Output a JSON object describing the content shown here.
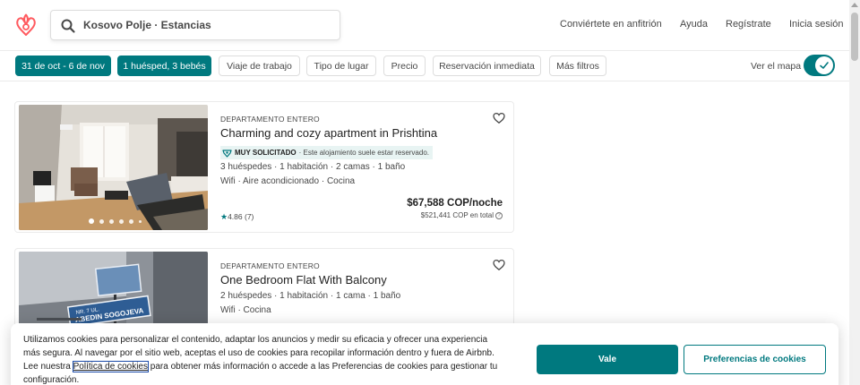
{
  "header": {
    "logo_icon": "airbnb-logo",
    "search_value": "Kosovo Polje · Estancias",
    "nav": [
      "Conviértete en anfitrión",
      "Ayuda",
      "Regístrate",
      "Inicia sesión"
    ]
  },
  "filters": {
    "dates": "31 de oct - 6 de nov",
    "guests": "1 huésped, 3 bebés",
    "work_trip": "Viaje de trabajo",
    "place_type": "Tipo de lugar",
    "price": "Precio",
    "instant_book": "Reservación inmediata",
    "more_filters": "Más filtros",
    "map_label": "Ver el mapa",
    "map_toggle_on": true
  },
  "listings": [
    {
      "type": "DEPARTAMENTO ENTERO",
      "title": "Charming and cozy apartment in Prishtina",
      "badge_strong": "MUY SOLICITADO",
      "badge_text": "· Este alojamiento suele estar reservado.",
      "details": "3 huéspedes · 1 habitación · 2 camas · 1 baño",
      "amenities": "Wifi · Aire acondicionado · Cocina",
      "price": "$67,588 COP/noche",
      "total": "$521,441 COP en total",
      "rating_value": "4.86",
      "rating_count": "(7)"
    },
    {
      "type": "DEPARTAMENTO ENTERO",
      "title": "One Bedroom Flat With Balcony",
      "details": "2 huéspedes · 1 habitación · 1 cama · 1 baño",
      "amenities": "Wifi · Cocina",
      "photo_sign_1": "NR. 7 UL.",
      "photo_sign_2": "ABEDIN SOGOJEVA"
    }
  ],
  "cookie": {
    "text_before": "Utilizamos cookies para personalizar el contenido, adaptar los anuncios y medir su eficacia y ofrecer una experiencia más segura. Al navegar por el sitio web, aceptas el uso de cookies para recopilar información dentro y fuera de Airbnb. Lee nuestra ",
    "link": "Política de cookies",
    "text_after": " para obtener más información o accede a las Preferencias de cookies para gestionar tu configuración.",
    "accept": "Vale",
    "preferences": "Preferencias de cookies"
  },
  "colors": {
    "brand": "#ff5a5f",
    "accent": "#00797f",
    "badge_bg": "#e8f4f3"
  }
}
